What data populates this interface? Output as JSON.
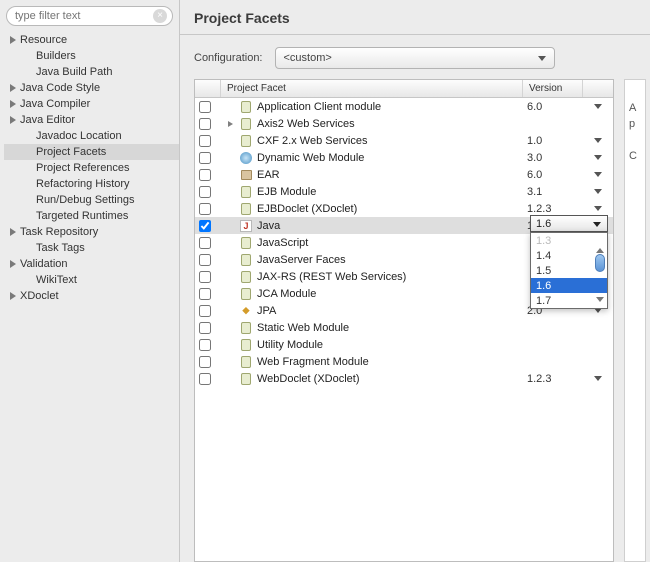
{
  "sidebar": {
    "filter_placeholder": "type filter text",
    "items": [
      {
        "label": "Resource",
        "expandable": true,
        "indent": 0
      },
      {
        "label": "Builders",
        "expandable": false,
        "indent": 1
      },
      {
        "label": "Java Build Path",
        "expandable": false,
        "indent": 1
      },
      {
        "label": "Java Code Style",
        "expandable": true,
        "indent": 0
      },
      {
        "label": "Java Compiler",
        "expandable": true,
        "indent": 0
      },
      {
        "label": "Java Editor",
        "expandable": true,
        "indent": 0
      },
      {
        "label": "Javadoc Location",
        "expandable": false,
        "indent": 1
      },
      {
        "label": "Project Facets",
        "expandable": false,
        "indent": 1,
        "selected": true
      },
      {
        "label": "Project References",
        "expandable": false,
        "indent": 1
      },
      {
        "label": "Refactoring History",
        "expandable": false,
        "indent": 1
      },
      {
        "label": "Run/Debug Settings",
        "expandable": false,
        "indent": 1
      },
      {
        "label": "Targeted Runtimes",
        "expandable": false,
        "indent": 1
      },
      {
        "label": "Task Repository",
        "expandable": true,
        "indent": 0
      },
      {
        "label": "Task Tags",
        "expandable": false,
        "indent": 1
      },
      {
        "label": "Validation",
        "expandable": true,
        "indent": 0
      },
      {
        "label": "WikiText",
        "expandable": false,
        "indent": 1
      },
      {
        "label": "XDoclet",
        "expandable": true,
        "indent": 0
      }
    ]
  },
  "main": {
    "title": "Project Facets",
    "config_label": "Configuration:",
    "config_value": "<custom>",
    "table": {
      "header_facet": "Project Facet",
      "header_version": "Version",
      "rows": [
        {
          "checked": false,
          "expandable": false,
          "label": "Application Client module",
          "version": "6.0",
          "caret": true,
          "icon": "doc"
        },
        {
          "checked": false,
          "expandable": true,
          "label": "Axis2 Web Services",
          "version": "",
          "caret": false,
          "icon": "doc"
        },
        {
          "checked": false,
          "expandable": false,
          "label": "CXF 2.x Web Services",
          "version": "1.0",
          "caret": true,
          "icon": "doc"
        },
        {
          "checked": false,
          "expandable": false,
          "label": "Dynamic Web Module",
          "version": "3.0",
          "caret": true,
          "icon": "globe"
        },
        {
          "checked": false,
          "expandable": false,
          "label": "EAR",
          "version": "6.0",
          "caret": true,
          "icon": "ear"
        },
        {
          "checked": false,
          "expandable": false,
          "label": "EJB Module",
          "version": "3.1",
          "caret": true,
          "icon": "doc"
        },
        {
          "checked": false,
          "expandable": false,
          "label": "EJBDoclet (XDoclet)",
          "version": "1.2.3",
          "caret": true,
          "icon": "doc"
        },
        {
          "checked": true,
          "expandable": false,
          "label": "Java",
          "version": "1.6",
          "caret": true,
          "icon": "java",
          "selected": true
        },
        {
          "checked": false,
          "expandable": false,
          "label": "JavaScript",
          "version": "",
          "caret": false,
          "icon": "doc"
        },
        {
          "checked": false,
          "expandable": false,
          "label": "JavaServer Faces",
          "version": "",
          "caret": false,
          "icon": "doc"
        },
        {
          "checked": false,
          "expandable": false,
          "label": "JAX-RS (REST Web Services)",
          "version": "",
          "caret": false,
          "icon": "doc"
        },
        {
          "checked": false,
          "expandable": false,
          "label": "JCA Module",
          "version": "",
          "caret": false,
          "icon": "doc"
        },
        {
          "checked": false,
          "expandable": false,
          "label": "JPA",
          "version": "2.0",
          "caret": true,
          "icon": "jpa"
        },
        {
          "checked": false,
          "expandable": false,
          "label": "Static Web Module",
          "version": "",
          "caret": false,
          "icon": "doc"
        },
        {
          "checked": false,
          "expandable": false,
          "label": "Utility Module",
          "version": "",
          "caret": false,
          "icon": "doc"
        },
        {
          "checked": false,
          "expandable": false,
          "label": "Web Fragment Module",
          "version": "",
          "caret": false,
          "icon": "doc"
        },
        {
          "checked": false,
          "expandable": false,
          "label": "WebDoclet (XDoclet)",
          "version": "1.2.3",
          "caret": true,
          "icon": "doc"
        }
      ]
    },
    "version_popup": {
      "selected_display": "1.6",
      "options": [
        {
          "label": "1.3",
          "faded": true
        },
        {
          "label": "1.4"
        },
        {
          "label": "1.5"
        },
        {
          "label": "1.6",
          "selected": true
        },
        {
          "label": "1.7"
        }
      ]
    },
    "right_panel": {
      "line1": "A",
      "line2": "p",
      "line3": "C"
    }
  }
}
